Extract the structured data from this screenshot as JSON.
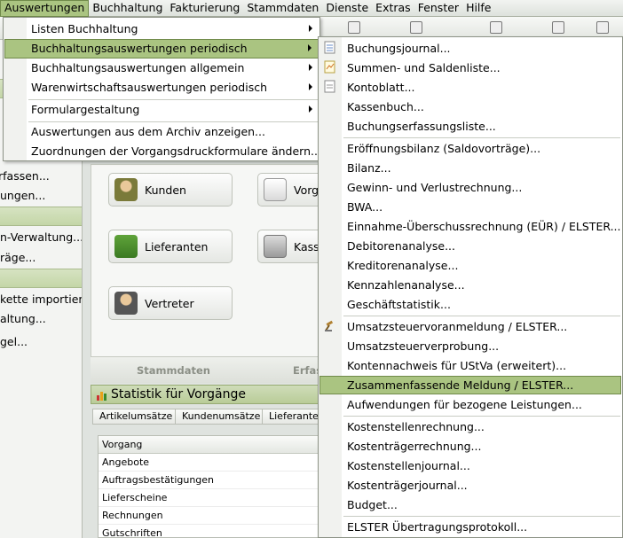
{
  "menubar": [
    "Auswertungen",
    "Buchhaltung",
    "Fakturierung",
    "Stammdaten",
    "Dienste",
    "Extras",
    "Fenster",
    "Hilfe"
  ],
  "sidebar": {
    "lines": [
      "rfassen...",
      "ungen...",
      "n-Verwaltung...",
      "räge...",
      "kette importiere",
      "altung...",
      "gel..."
    ]
  },
  "tiles": {
    "buttons": [
      "Kunden",
      "Lieferanten",
      "Vertreter"
    ],
    "buttons_right": [
      "Vorg",
      "Kass"
    ],
    "footer": [
      "Stammdaten",
      "Erfas"
    ]
  },
  "statistics": {
    "title": "Statistik für Vorgänge",
    "tabs": [
      "Artikelumsätze",
      "Kundenumsätze",
      "Lieferanten"
    ],
    "column_header": "Vorgang",
    "rows": [
      "Angebote",
      "Auftragsbestätigungen",
      "Lieferscheine",
      "Rechnungen",
      "Gutschriften"
    ]
  },
  "menu_auswertungen": {
    "items": [
      {
        "label": "Listen Buchhaltung",
        "submenu": true
      },
      {
        "label": "Buchhaltungsauswertungen periodisch",
        "submenu": true
      },
      {
        "label": "Buchhaltungsauswertungen allgemein",
        "submenu": true
      },
      {
        "label": "Warenwirtschaftsauswertungen periodisch",
        "submenu": true
      },
      {
        "label": "Formulargestaltung",
        "submenu": true
      },
      {
        "label": "Auswertungen aus dem Archiv anzeigen...",
        "submenu": false
      },
      {
        "label": "Zuordnungen der Vorgangsdruckformulare ändern...",
        "submenu": false
      }
    ]
  },
  "menu_periodisch": {
    "items": [
      "Buchungsjournal...",
      "Summen- und Saldenliste...",
      "Kontoblatt...",
      "Kassenbuch...",
      "Buchungserfassungsliste...",
      "Eröffnungsbilanz (Saldovorträge)...",
      "Bilanz...",
      "Gewinn- und Verlustrechnung...",
      "BWA...",
      "Einnahme-Überschussrechnung (EÜR) / ELSTER...",
      "Debitorenanalyse...",
      "Kreditorenanalyse...",
      "Kennzahlenanalyse...",
      "Geschäftstatistik...",
      "Umsatzsteuervoranmeldung / ELSTER...",
      "Umsatzsteuerverprobung...",
      "Kontennachweis für UStVa (erweitert)...",
      "Zusammenfassende Meldung / ELSTER...",
      "Aufwendungen für bezogene Leistungen...",
      "Kostenstellenrechnung...",
      "Kostenträgerrechnung...",
      "Kostenstellenjournal...",
      "Kostenträgerjournal...",
      "Budget...",
      "ELSTER Übertragungsprotokoll..."
    ]
  },
  "colors": {
    "highlight": "#aac481",
    "highlight_border": "#708a4a",
    "section_green": "#c4d6a7"
  }
}
